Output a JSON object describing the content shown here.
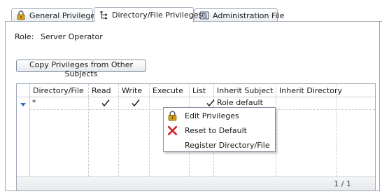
{
  "tabs": [
    {
      "label": "General Privileges",
      "icon": "lock-icon"
    },
    {
      "label": "Directory/File Privileges",
      "icon": "folder-tree-icon",
      "active": true
    },
    {
      "label": "Administration File",
      "icon": "admin-file-icon"
    }
  ],
  "role": {
    "label": "Role:",
    "value": "Server Operator"
  },
  "copy_button": {
    "label": "Copy Privileges from Other Subjects"
  },
  "table": {
    "columns": [
      "Directory/File",
      "Read",
      "Write",
      "Execute",
      "List",
      "Inherit Subject",
      "Inherit Directory"
    ],
    "rows": [
      {
        "directory": "*",
        "read": true,
        "write": true,
        "execute": false,
        "list": true,
        "inherit_subject": "Role default",
        "inherit_directory": ""
      }
    ],
    "pager": "1 / 1"
  },
  "context_menu": {
    "items": [
      {
        "label": "Edit Privileges",
        "icon": "lock-icon"
      },
      {
        "label": "Reset to Default",
        "icon": "red-x-icon"
      },
      {
        "label": "Register Directory/File",
        "icon": ""
      }
    ]
  },
  "colors": {
    "border": "#9fa9b6",
    "sort_indicator": "#2f6fc9",
    "reset_icon": "#d11a1a",
    "lock_body": "#d9a21b"
  }
}
